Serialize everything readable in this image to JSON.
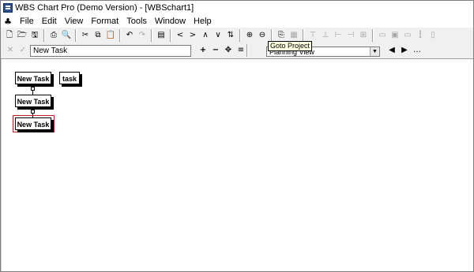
{
  "window": {
    "title": "WBS Chart Pro (Demo Version) - [WBSchart1]"
  },
  "menu": {
    "items": [
      "File",
      "Edit",
      "View",
      "Format",
      "Tools",
      "Window",
      "Help"
    ]
  },
  "toolbar2": {
    "task_name_value": "New Task",
    "tooltip": "Goto Project",
    "view_select": "Planning View"
  },
  "chart": {
    "tasks": [
      "New Task",
      "task",
      "New Task",
      "New Task"
    ]
  }
}
